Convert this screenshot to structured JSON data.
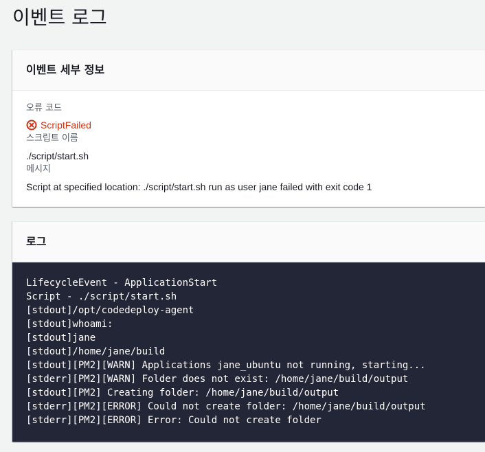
{
  "page": {
    "title": "이벤트 로그"
  },
  "details": {
    "header": "이벤트 세부 정보",
    "error_code_label": "오류 코드",
    "error_code_value": "ScriptFailed",
    "error_icon": "error-circle-x-icon",
    "script_name_label": "스크립트 이름",
    "script_name_value": "./script/start.sh",
    "message_label": "메시지",
    "message_value": "Script at specified location: ./script/start.sh run as user jane failed with exit code 1"
  },
  "logs": {
    "header": "로그",
    "lines": [
      "LifecycleEvent - ApplicationStart",
      "Script - ./script/start.sh",
      "[stdout]/opt/codedeploy-agent",
      "[stdout]whoami:",
      "[stdout]jane",
      "[stdout]/home/jane/build",
      "[stdout][PM2][WARN] Applications jane_ubuntu not running, starting...",
      "[stderr][PM2][WARN] Folder does not exist: /home/jane/build/output",
      "[stdout][PM2] Creating folder: /home/jane/build/output",
      "[stderr][PM2][ERROR] Could not create folder: /home/jane/build/output",
      "[stderr][PM2][ERROR] Error: Could not create folder"
    ]
  },
  "colors": {
    "error": "#d13212",
    "log_background": "#232636",
    "page_background": "#f2f3f3"
  }
}
